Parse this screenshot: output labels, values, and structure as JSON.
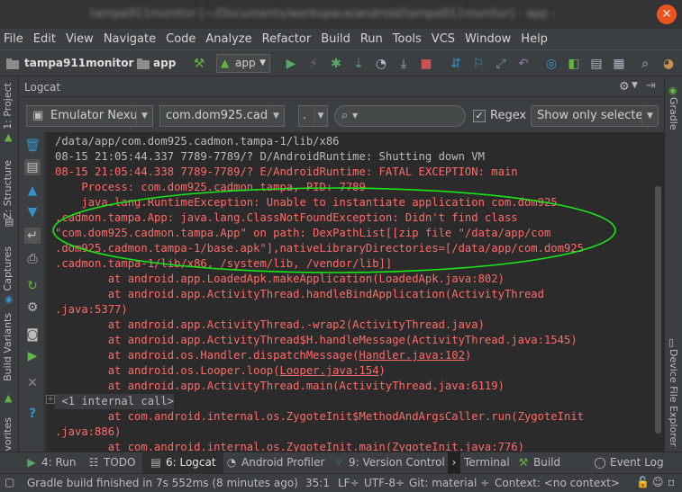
{
  "window": {
    "title": "tampa911monitor [~/Documents/workspace/android/tampa911monitor] - app - Android Studio",
    "close_label": "×"
  },
  "menu": [
    "File",
    "Edit",
    "View",
    "Navigate",
    "Code",
    "Analyze",
    "Refactor",
    "Build",
    "Run",
    "Tools",
    "VCS",
    "Window",
    "Help"
  ],
  "nav": {
    "project": "tampa911monitor",
    "module": "app",
    "run_config": "app"
  },
  "side_tabs_left": [
    "1: Project",
    "Z: Structure",
    "Captures",
    "Build Variants",
    "avorites"
  ],
  "side_tabs_right": [
    "Gradle",
    "Device File Explorer"
  ],
  "logcat": {
    "title": "Logcat",
    "device": "Emulator Nexu",
    "package": "com.dom925.cadm",
    "level": ".",
    "search_value": "",
    "regex_label": "Regex",
    "regex_checked": true,
    "filter": "Show only selecte",
    "lines": [
      {
        "text": "/data/app/com.dom925.cadmon.tampa-1/lib/x86",
        "color": "grey"
      },
      {
        "text": "08-15 21:05:44.337 7789-7789/? D/AndroidRuntime: Shutting down VM",
        "color": "grey"
      },
      {
        "text": "08-15 21:05:44.338 7789-7789/? E/AndroidRuntime: FATAL EXCEPTION: main",
        "color": "red"
      },
      {
        "text": "    Process: com.dom925.cadmon.tampa, PID: 7789",
        "color": "red"
      },
      {
        "text": "    java.lang.RuntimeException: Unable to instantiate application com.dom925",
        "color": "red"
      },
      {
        "text": ".cadmon.tampa.App: java.lang.ClassNotFoundException: Didn't find class",
        "color": "red"
      },
      {
        "text": "\"com.dom925.cadmon.tampa.App\" on path: DexPathList[[zip file \"/data/app/com",
        "color": "red"
      },
      {
        "text": ".dom925.cadmon.tampa-1/base.apk\"],nativeLibraryDirectories=[/data/app/com.dom925",
        "color": "red"
      },
      {
        "text": ".cadmon.tampa-1/lib/x86, /system/lib, /vendor/lib]]",
        "color": "red"
      },
      {
        "text": "        at android.app.LoadedApk.makeApplication(LoadedApk.java:802)",
        "color": "red"
      },
      {
        "text": "        at android.app.ActivityThread.handleBindApplication(ActivityThread",
        "color": "red"
      },
      {
        "text": ".java:5377)",
        "color": "red"
      },
      {
        "text": "        at android.app.ActivityThread.-wrap2(ActivityThread.java)",
        "color": "red"
      },
      {
        "text": "        at android.app.ActivityThread$H.handleMessage(ActivityThread.java:1545)",
        "color": "red"
      },
      {
        "text": "        at android.os.Handler.dispatchMessage(Handler.java:102)",
        "color": "red"
      },
      {
        "text": "        at android.os.Looper.loop(Looper.java:154)",
        "color": "red"
      },
      {
        "text": "        at android.app.ActivityThread.main(ActivityThread.java:6119)",
        "color": "red"
      },
      {
        "text": " <1 internal call>",
        "color": "grey"
      },
      {
        "text": "        at com.android.internal.os.ZygoteInit$MethodAndArgsCaller.run(ZygoteInit",
        "color": "red"
      },
      {
        "text": ".java:886)",
        "color": "red"
      },
      {
        "text": "        at com.android.internal.os.ZygoteInit.main(ZygoteInit.java:776)",
        "color": "red"
      }
    ]
  },
  "bottom_tabs": [
    {
      "label": "4: Run",
      "icon": "run-icon"
    },
    {
      "label": "TODO",
      "icon": "todo-icon"
    },
    {
      "label": "6: Logcat",
      "icon": "logcat-icon",
      "active": true
    },
    {
      "label": "Android Profiler",
      "icon": "profiler-icon"
    },
    {
      "label": "9: Version Control",
      "icon": "vcs-icon"
    },
    {
      "label": "Terminal",
      "icon": "terminal-icon"
    },
    {
      "label": "Build",
      "icon": "build-icon"
    },
    {
      "label": "Event Log",
      "icon": "event-log-icon"
    }
  ],
  "status": {
    "message": "Gradle build finished in 7s 552ms (8 minutes ago)",
    "position": "35:1",
    "line_sep": "LF÷",
    "encoding": "UTF-8÷",
    "git": "Git: material ÷",
    "context": "Context: <no context>"
  },
  "colors": {
    "accent_close": "#e95420",
    "log_error": "#ff6b68",
    "annotation": "#19e619"
  }
}
